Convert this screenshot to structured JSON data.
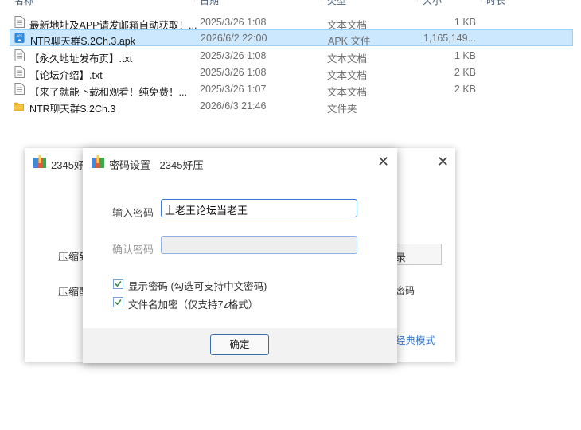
{
  "file_list": {
    "header": {
      "name": "名称",
      "date": "日期",
      "type": "类型",
      "size": "大小",
      "duration": "时长"
    },
    "rows": [
      {
        "name": "最新地址及APP请发邮箱自动获取！...",
        "date": "2025/3/26 1:08",
        "type": "文本文档",
        "size": "1 KB",
        "icon": "text-file-icon",
        "selected": false
      },
      {
        "name": "NTR聊天群S.2Ch.3.apk",
        "date": "2026/6/2 22:00",
        "type": "APK 文件",
        "size": "1,165,149...",
        "icon": "apk-file-icon",
        "selected": true
      },
      {
        "name": "【永久地址发布页】.txt",
        "date": "2025/3/26 1:08",
        "type": "文本文档",
        "size": "1 KB",
        "icon": "text-file-icon",
        "selected": false
      },
      {
        "name": "【论坛介绍】.txt",
        "date": "2025/3/26 1:08",
        "type": "文本文档",
        "size": "2 KB",
        "icon": "text-file-icon",
        "selected": false
      },
      {
        "name": "【来了就能下载和观看！纯免费！...",
        "date": "2025/3/26 1:07",
        "type": "文本文档",
        "size": "2 KB",
        "icon": "text-file-icon",
        "selected": false
      },
      {
        "name": "NTR聊天群S.2Ch.3",
        "date": "2026/6/3 21:46",
        "type": "文件夹",
        "size": "",
        "icon": "folder-icon",
        "selected": false
      }
    ]
  },
  "background_window": {
    "title": "2345好压",
    "label_1": "压缩到",
    "label_2": "压缩配",
    "button_partial": "录",
    "password_partial": "密码",
    "classic_link": "经典模式"
  },
  "password_dialog": {
    "title": "密码设置 - 2345好压",
    "password_label": "输入密码",
    "password_value": "上老王论坛当老王",
    "confirm_label": "确认密码",
    "confirm_value": "",
    "show_password": {
      "label": "显示密码 (勾选可支持中文密码)",
      "checked": true
    },
    "encrypt_names": {
      "label": "文件名加密（仅支持7z格式）",
      "checked": true
    },
    "ok_label": "确定"
  },
  "colors": {
    "selection_bg": "#cce8ff",
    "selection_border": "#99d1ff",
    "accent": "#3a7bd5",
    "folder": "#f5c542",
    "check": "#3a8a3a"
  }
}
